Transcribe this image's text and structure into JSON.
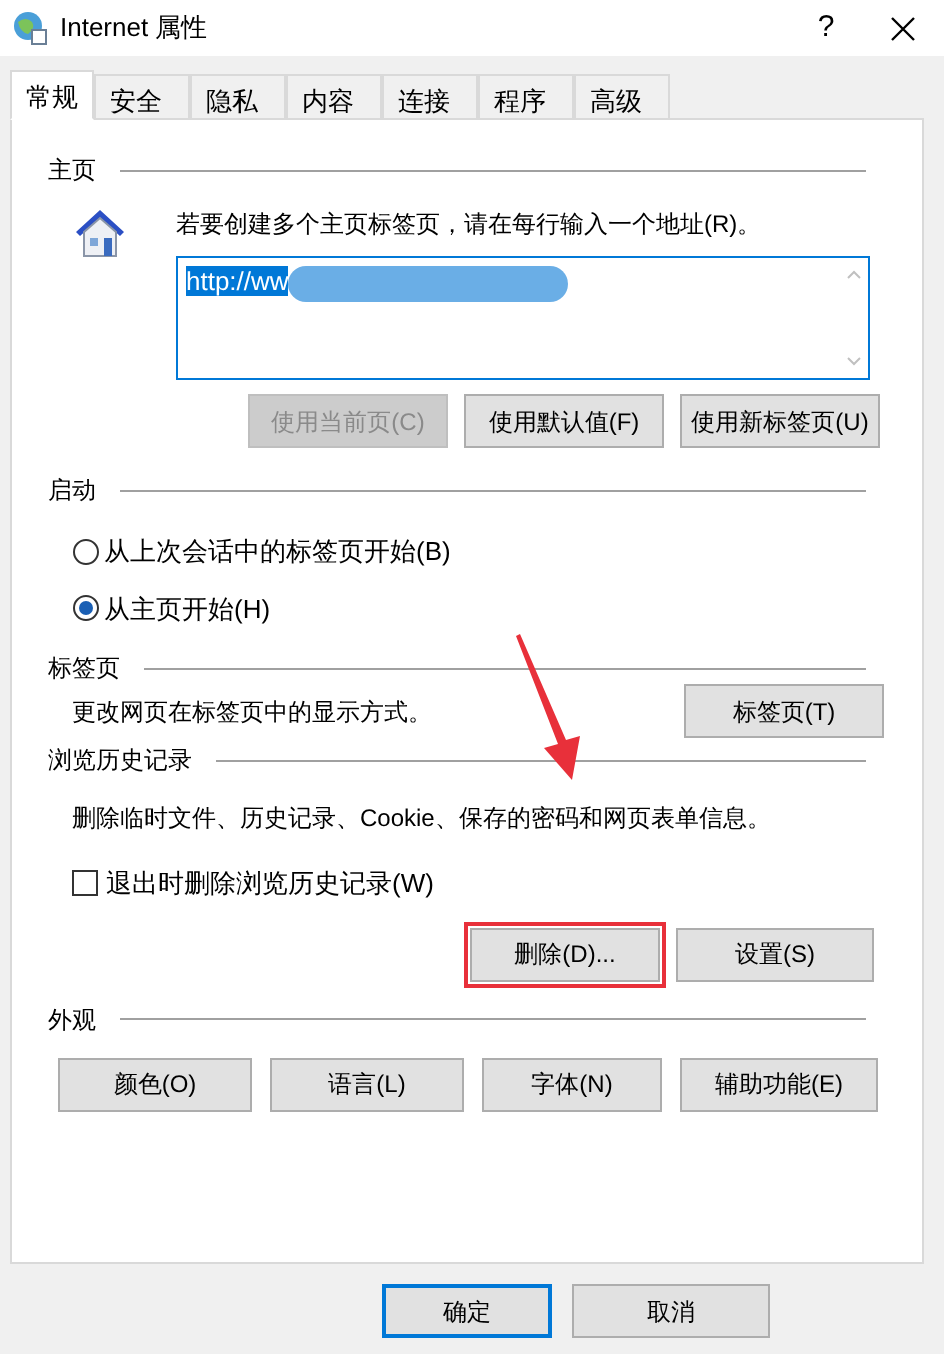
{
  "window": {
    "title": "Internet 属性",
    "help": "?"
  },
  "tabs": [
    {
      "label": "常规",
      "selected": true
    },
    {
      "label": "安全",
      "selected": false
    },
    {
      "label": "隐私",
      "selected": false
    },
    {
      "label": "内容",
      "selected": false
    },
    {
      "label": "连接",
      "selected": false
    },
    {
      "label": "程序",
      "selected": false
    },
    {
      "label": "高级",
      "selected": false
    }
  ],
  "home_page": {
    "heading": "主页",
    "hint": "若要创建多个主页标签页，请在每行输入一个地址(R)。",
    "value": "http://ww",
    "selected": true,
    "redacted": true,
    "buttons": [
      {
        "label": "使用当前页(C)",
        "disabled": true
      },
      {
        "label": "使用默认值(F)",
        "disabled": false
      },
      {
        "label": "使用新标签页(U)",
        "disabled": false
      }
    ]
  },
  "startup": {
    "heading": "启动",
    "options": [
      {
        "label": "从上次会话中的标签页开始(B)",
        "selected": false
      },
      {
        "label": "从主页开始(H)",
        "selected": true
      }
    ]
  },
  "tabs_section": {
    "heading": "标签页",
    "text": "更改网页在标签页中的显示方式。",
    "button": "标签页(T)"
  },
  "history": {
    "heading": "浏览历史记录",
    "text": "删除临时文件、历史记录、Cookie、保存的密码和网页表单信息。",
    "checkbox": {
      "label": "退出时删除浏览历史记录(W)",
      "checked": false
    },
    "buttons": [
      {
        "label": "删除(D)...",
        "highlighted": true
      },
      {
        "label": "设置(S)",
        "highlighted": false
      }
    ]
  },
  "appearance": {
    "heading": "外观",
    "buttons": [
      "颜色(O)",
      "语言(L)",
      "字体(N)",
      "辅助功能(E)"
    ]
  },
  "footer": {
    "buttons": [
      {
        "label": "确定",
        "default": true
      },
      {
        "label": "取消",
        "default": false
      }
    ]
  }
}
